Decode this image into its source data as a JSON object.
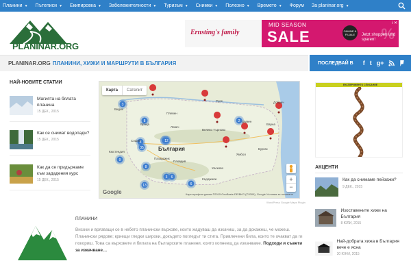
{
  "nav": {
    "items": [
      {
        "label": "Планини",
        "caret": true
      },
      {
        "label": "Пътеписи",
        "caret": true
      },
      {
        "label": "Екипировка",
        "caret": true
      },
      {
        "label": "Забележителности",
        "caret": true
      },
      {
        "label": "Туризъм",
        "caret": true
      },
      {
        "label": "Снимки",
        "caret": true
      },
      {
        "label": "Полезно",
        "caret": true
      },
      {
        "label": "Времето",
        "caret": true
      },
      {
        "label": "Форум",
        "caret": false
      },
      {
        "label": "За planinar.org",
        "caret": true
      }
    ],
    "search_icon": "search-icon"
  },
  "header": {
    "logo_text": "PLANINAR.ORG"
  },
  "ad": {
    "brand": "Ernsting's family",
    "mid": "MID SEASON",
    "sale": "SALE",
    "badge": "ONLINE & FILIALE",
    "percent": "%",
    "small": "Jetzt shoppen und sparen!",
    "info": "i ✕"
  },
  "titlebar": {
    "site": "PLANINAR.ORG",
    "tagline": "ПЛАНИНИ, ХИЖИ И МАРШРУТИ В БЪЛГАРИЯ"
  },
  "lastin": {
    "label": "ПОСЛЕДВАЙ В",
    "socials": [
      "f",
      "t",
      "g+",
      "rss",
      "4"
    ]
  },
  "latest": {
    "heading": "НАЙ-НОВИТЕ СТАТИИ",
    "articles": [
      {
        "title": "Магията на бялата планина",
        "date": "15 ДЕК., 2015"
      },
      {
        "title": "Как се снимат водопади?",
        "date": "15 ДЕК., 2015"
      },
      {
        "title": "Как да се придържаме към зададения курс",
        "date": "15 ДЕК., 2015"
      }
    ]
  },
  "map": {
    "tab_map": "Карта",
    "tab_sat": "Сателит",
    "country": "България",
    "cities": [
      "Видин",
      "Русе",
      "Плевен",
      "Велико Търново",
      "Варна",
      "София",
      "Бургас",
      "Пловдив",
      "Враца",
      "Ловеч",
      "Ямбол",
      "Пазарджик",
      "Кърджали",
      "Хасково",
      "Шумен",
      "Добрич",
      "Кюстендил"
    ],
    "credit": "Картографски данни ©2015 GeoBasis-DE/BKG (©2009), Google  Условия за ползване",
    "google": "Google",
    "clusters": [
      "3",
      "8",
      "2",
      "8",
      "4",
      "35",
      "9",
      "8",
      "6",
      "13",
      "6",
      "4",
      "12",
      "3"
    ],
    "note": "WordPress Google Maps Plugin"
  },
  "mountains": {
    "heading": "ПЛАНИНИ",
    "text": "Високи и врязващи се в небето планински върхове, които жадуваш да изкачиш, за да докажеш, че можеш. Планински рядове; криещи гледки широки, докъдето погледът ти стига. Привлечени била, които те очакват да ги покориш. Това са върховете и билата на българските планини, които копнеещ да изкачваме.",
    "more": "Подходи и съвети за изкачване…"
  },
  "sidebar": {
    "ad_strip": "ЕКСПЕРИМЕНТО СПИСАНИЕ",
    "accents_heading": "АКЦЕНТИ",
    "accents": [
      {
        "title": "Как да снимаме пейзажи?",
        "date": "9 ДЕК., 2015"
      },
      {
        "title": "Изоставените хижи на България",
        "date": "8 ЮЛИ, 2015"
      },
      {
        "title": "Най-добрата хижа в България вече е ясна",
        "date": "30 ЮНИ, 2015"
      }
    ]
  },
  "colors": {
    "nav_blue": "#2f80c8",
    "logo_green": "#2b6e3a",
    "marker_red": "#d83a3a",
    "cluster_blue": "#3f7fd0"
  }
}
